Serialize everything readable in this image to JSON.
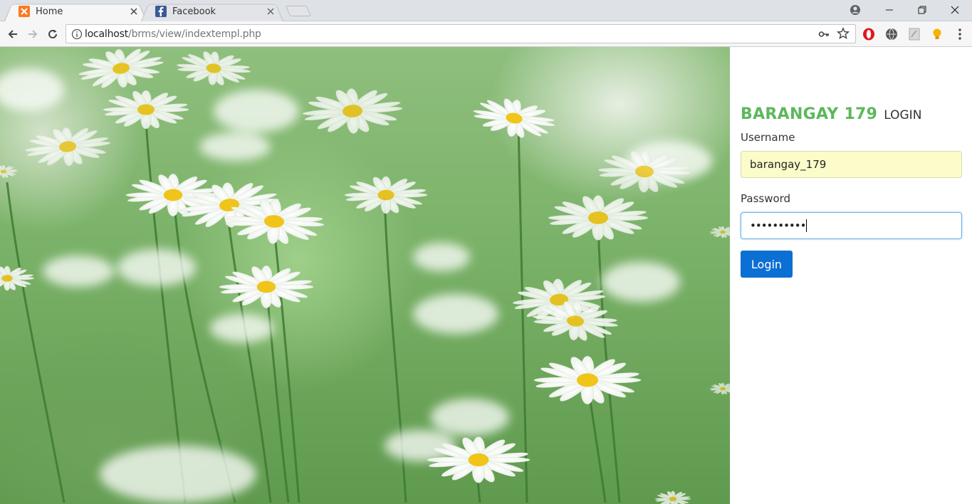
{
  "browser": {
    "tabs": [
      {
        "title": "Home",
        "active": true,
        "favicon": "xampp-icon"
      },
      {
        "title": "Facebook",
        "active": false,
        "favicon": "facebook-icon"
      }
    ],
    "address": {
      "host": "localhost",
      "path": "/brms/view/indextempl.php"
    },
    "extensions": [
      "opera-icon",
      "globe-extension-icon",
      "pdf-extension-icon",
      "lightbulb-extension-icon"
    ]
  },
  "login": {
    "brand": "BARANGAY 179",
    "heading_suffix": "LOGIN",
    "username_label": "Username",
    "username_value": "barangay_179",
    "password_label": "Password",
    "password_masked": "••••••••••",
    "button_label": "Login"
  },
  "colors": {
    "brand_green": "#5cb85c",
    "button_blue": "#0b6fd3",
    "autofill_yellow": "#fbfcc9"
  }
}
